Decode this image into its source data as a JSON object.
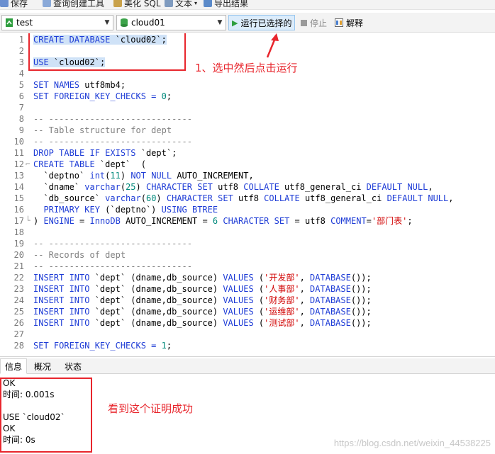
{
  "menubar": {
    "items": [
      "保存",
      "查询创建工具",
      "美化 SQL",
      "文本",
      "导出结果"
    ]
  },
  "toolbar": {
    "connection": "test",
    "database": "cloud01",
    "run_selected": "运行已选择的",
    "stop": "停止",
    "explain": "解释"
  },
  "editor": {
    "lines": [
      {
        "n": "1"
      },
      {
        "n": "2"
      },
      {
        "n": "3"
      },
      {
        "n": "4"
      },
      {
        "n": "5"
      },
      {
        "n": "6"
      },
      {
        "n": "7"
      },
      {
        "n": "8"
      },
      {
        "n": "9"
      },
      {
        "n": "10"
      },
      {
        "n": "11"
      },
      {
        "n": "12"
      },
      {
        "n": "13"
      },
      {
        "n": "14"
      },
      {
        "n": "15"
      },
      {
        "n": "16"
      },
      {
        "n": "17"
      },
      {
        "n": "18"
      },
      {
        "n": "19"
      },
      {
        "n": "20"
      },
      {
        "n": "21"
      },
      {
        "n": "22"
      },
      {
        "n": "23"
      },
      {
        "n": "24"
      },
      {
        "n": "25"
      },
      {
        "n": "26"
      },
      {
        "n": "27"
      },
      {
        "n": "28"
      }
    ],
    "code": {
      "l1": [
        "CREATE DATABASE ",
        "`cloud02`",
        ";"
      ],
      "l3": [
        "USE ",
        "`cloud02`",
        ";"
      ],
      "l5": [
        "SET NAMES ",
        "utf8mb4;"
      ],
      "l6": [
        "SET FOREIGN_KEY_CHECKS = ",
        "0",
        ";"
      ],
      "l8": "-- ----------------------------",
      "l9": "-- Table structure for dept",
      "l10": "-- ----------------------------",
      "l11": [
        "DROP TABLE IF EXISTS ",
        "`dept`;"
      ],
      "l12": [
        "CREATE TABLE ",
        "`dept`  ("
      ],
      "l13": [
        "  `deptno` ",
        "int",
        "(",
        "11",
        ") ",
        "NOT NULL",
        " AUTO_INCREMENT,"
      ],
      "l14": [
        "  `dname` ",
        "varchar",
        "(",
        "25",
        ") ",
        "CHARACTER SET",
        " utf8 ",
        "COLLATE",
        " utf8_general_ci ",
        "DEFAULT NULL",
        ","
      ],
      "l15": [
        "  `db_source` ",
        "varchar",
        "(",
        "60",
        ") ",
        "CHARACTER SET",
        " utf8 ",
        "COLLATE",
        " utf8_general_ci ",
        "DEFAULT NULL",
        ","
      ],
      "l16": [
        "  PRIMARY KEY",
        " (`deptno`) ",
        "USING BTREE"
      ],
      "l17": [
        ") ",
        "ENGINE",
        " = ",
        "InnoDB",
        " AUTO_INCREMENT = ",
        "6",
        " ",
        "CHARACTER SET",
        " = utf8 ",
        "COMMENT",
        "=",
        "'部门表'",
        ";"
      ],
      "l19": "-- ----------------------------",
      "l20": "-- Records of dept",
      "l21": "-- ----------------------------",
      "inserts": [
        {
          "dept": "'开发部'"
        },
        {
          "dept": "'人事部'"
        },
        {
          "dept": "'财务部'"
        },
        {
          "dept": "'运维部'"
        },
        {
          "dept": "'测试部'"
        }
      ],
      "insert_parts": [
        "INSERT INTO ",
        "`dept` (dname,db_source) ",
        "VALUES",
        " (",
        ", ",
        "DATABASE",
        "());"
      ],
      "l28": [
        "SET FOREIGN_KEY_CHECKS = ",
        "1",
        ";"
      ]
    }
  },
  "annotations": {
    "step1": "1、选中然后点击运行",
    "proof": "看到这个证明成功"
  },
  "panel": {
    "tabs": [
      "信息",
      "概况",
      "状态"
    ],
    "messages": [
      "OK",
      "时间: 0.001s",
      "",
      "USE `cloud02`",
      "OK",
      "时间: 0s"
    ]
  },
  "watermark": "https://blog.csdn.net/weixin_44538225",
  "colors": {
    "keyword": "#1e3cd6",
    "comment": "#808080",
    "number": "#00897b",
    "string": "#d10000",
    "annotation": "#e8262d",
    "selection": "#cfe2f7"
  }
}
